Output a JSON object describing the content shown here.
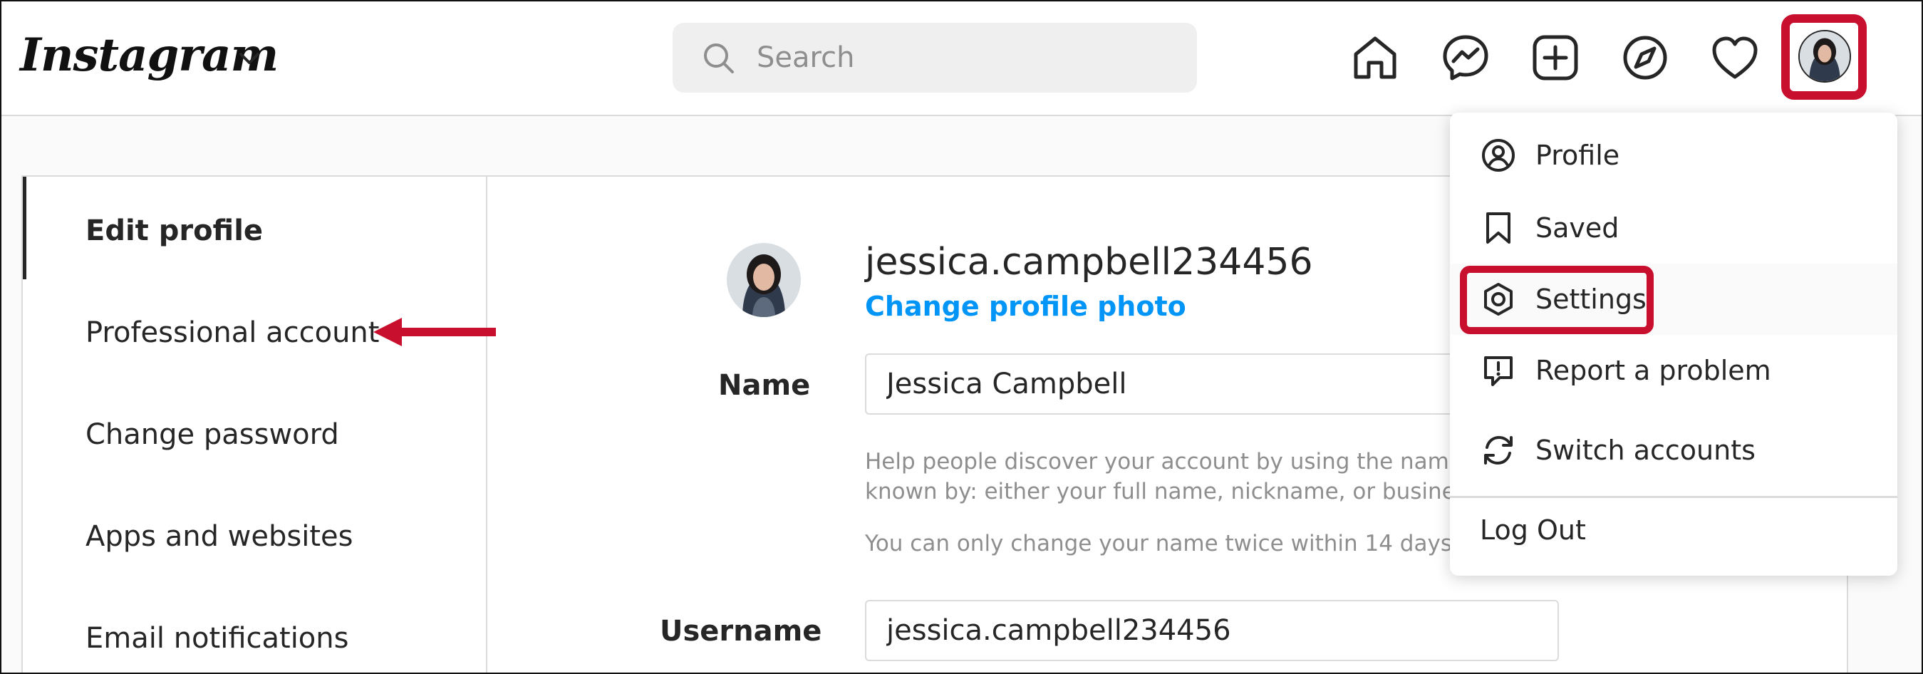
{
  "header": {
    "logo": "Instagram",
    "search_placeholder": "Search"
  },
  "nav_icons": [
    "home-icon",
    "messenger-icon",
    "new-post-icon",
    "explore-icon",
    "activity-heart-icon",
    "profile-avatar"
  ],
  "sidebar": {
    "items": [
      {
        "label": "Edit profile",
        "active": true
      },
      {
        "label": "Professional account"
      },
      {
        "label": "Change password"
      },
      {
        "label": "Apps and websites"
      },
      {
        "label": "Email notifications"
      }
    ]
  },
  "profile": {
    "username": "jessica.campbell234456",
    "change_photo_label": "Change profile photo",
    "name_label": "Name",
    "name_value": "Jessica Campbell",
    "name_help_1": "Help people discover your account by using the name yo",
    "name_help_2": "known by: either your full name, nickname, or business n",
    "name_help_3": "You can only change your name twice within 14 days.",
    "username_label": "Username",
    "username_value": "jessica.campbell234456"
  },
  "menu": {
    "items": [
      {
        "label": "Profile",
        "icon": "profile-circle-icon"
      },
      {
        "label": "Saved",
        "icon": "bookmark-icon"
      },
      {
        "label": "Settings",
        "icon": "gear-icon",
        "highlighted": true
      },
      {
        "label": "Report a problem",
        "icon": "report-icon"
      },
      {
        "label": "Switch accounts",
        "icon": "switch-accounts-icon"
      }
    ],
    "logout": "Log Out"
  },
  "colors": {
    "annotation_red": "#c8102e",
    "link_blue": "#0095f6",
    "border_gray": "#dbdbdb"
  }
}
